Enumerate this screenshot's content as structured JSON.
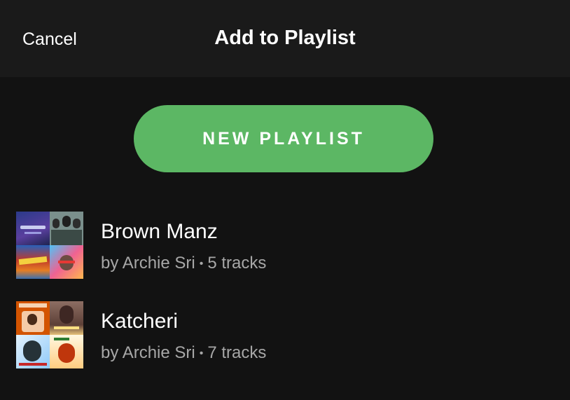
{
  "header": {
    "cancel_label": "Cancel",
    "title": "Add to Playlist"
  },
  "actions": {
    "new_playlist_label": "NEW PLAYLIST",
    "accent_color": "#5cb764"
  },
  "playlists": [
    {
      "name": "Brown Manz",
      "owner": "by Archie Sri",
      "separator": "•",
      "tracks": "5 tracks",
      "cover_icon": "playlist-mosaic-cover"
    },
    {
      "name": "Katcheri",
      "owner": "by Archie Sri",
      "separator": "•",
      "tracks": "7 tracks",
      "cover_icon": "playlist-mosaic-cover"
    }
  ]
}
